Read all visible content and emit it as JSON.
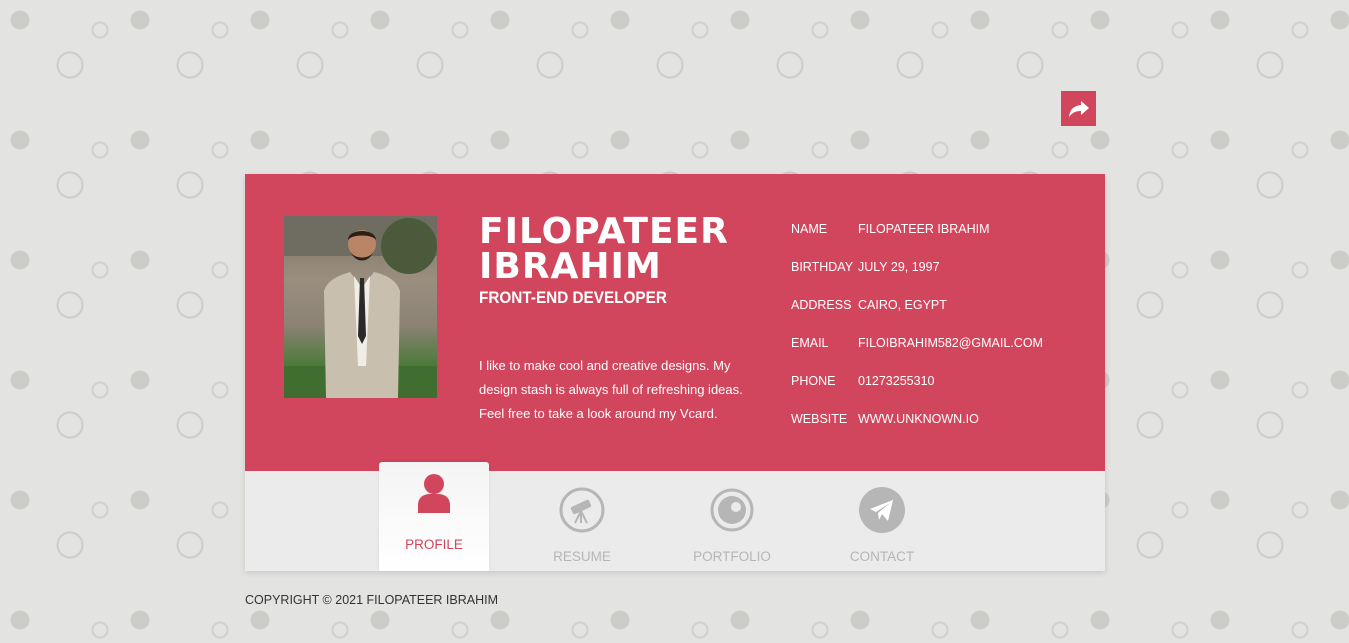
{
  "profile": {
    "name": "FILOPATEER IBRAHIM",
    "role": "FRONT-END DEVELOPER",
    "bio": "I like to make cool and creative designs. My design stash is always full of refreshing ideas. Feel free to take a look around my Vcard."
  },
  "info": [
    {
      "label": "NAME",
      "value": "FILOPATEER IBRAHIM"
    },
    {
      "label": "BIRTHDAY",
      "value": "JULY 29, 1997"
    },
    {
      "label": "ADDRESS",
      "value": "CAIRO, EGYPT"
    },
    {
      "label": "EMAIL",
      "value": "FILOIBRAHIM582@GMAIL.COM"
    },
    {
      "label": "PHONE",
      "value": "01273255310"
    },
    {
      "label": "WEBSITE",
      "value": "WWW.UNKNOWN.IO"
    }
  ],
  "nav": [
    {
      "label": "PROFILE",
      "icon": "user-icon",
      "active": true
    },
    {
      "label": "RESUME",
      "icon": "telescope-icon",
      "active": false
    },
    {
      "label": "PORTFOLIO",
      "icon": "eye-icon",
      "active": false
    },
    {
      "label": "CONTACT",
      "icon": "paper-plane-icon",
      "active": false
    }
  ],
  "footer": "COPYRIGHT © 2021 FILOPATEER IBRAHIM",
  "colors": {
    "accent": "#d2465d",
    "nav_bg": "#ebebeb",
    "inactive": "#b6b6b6"
  },
  "share_icon": "share-icon"
}
